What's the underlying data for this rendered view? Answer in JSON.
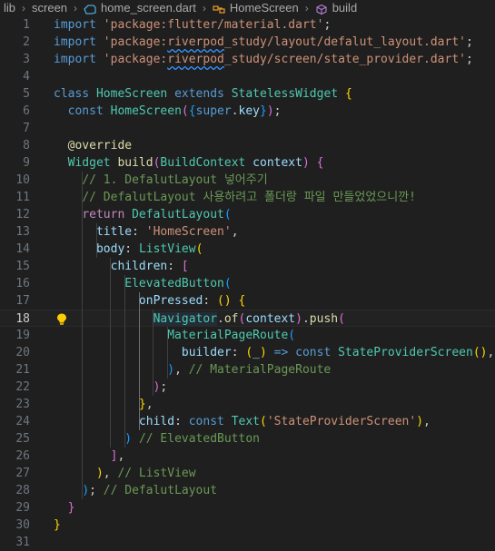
{
  "breadcrumb": {
    "items": [
      "lib",
      "screen",
      "home_screen.dart",
      "HomeScreen",
      "build"
    ]
  },
  "editor": {
    "active_line": 18,
    "lines": [
      {
        "n": "1",
        "tokens": [
          [
            "kw",
            "import"
          ],
          [
            "punc",
            " "
          ],
          [
            "str",
            "'package:flutter/material.dart'"
          ],
          [
            "punc",
            ";"
          ]
        ]
      },
      {
        "n": "2",
        "tokens": [
          [
            "kw",
            "import"
          ],
          [
            "punc",
            " "
          ],
          [
            "str",
            "'package:"
          ],
          [
            "str sq",
            "riverpod"
          ],
          [
            "str",
            "_study/layout/defalut_layout.dart'"
          ],
          [
            "punc",
            ";"
          ]
        ]
      },
      {
        "n": "3",
        "tokens": [
          [
            "kw",
            "import"
          ],
          [
            "punc",
            " "
          ],
          [
            "str",
            "'package:"
          ],
          [
            "str sq",
            "riverpod"
          ],
          [
            "str",
            "_study/screen/state_provider.dart'"
          ],
          [
            "punc",
            ";"
          ]
        ]
      },
      {
        "n": "4",
        "tokens": []
      },
      {
        "n": "5",
        "tokens": [
          [
            "kw",
            "class"
          ],
          [
            "punc",
            " "
          ],
          [
            "cls",
            "HomeScreen"
          ],
          [
            "punc",
            " "
          ],
          [
            "kw",
            "extends"
          ],
          [
            "punc",
            " "
          ],
          [
            "cls",
            "StatelessWidget"
          ],
          [
            "punc",
            " "
          ],
          [
            "b1",
            "{"
          ]
        ]
      },
      {
        "n": "6",
        "tokens": [
          [
            "punc",
            "  "
          ],
          [
            "kw",
            "const"
          ],
          [
            "punc",
            " "
          ],
          [
            "cls",
            "HomeScreen"
          ],
          [
            "b2",
            "("
          ],
          [
            "b3",
            "{"
          ],
          [
            "kw",
            "super"
          ],
          [
            "punc",
            "."
          ],
          [
            "var",
            "key"
          ],
          [
            "b3",
            "}"
          ],
          [
            "b2",
            ")"
          ],
          [
            "punc",
            ";"
          ]
        ]
      },
      {
        "n": "7",
        "tokens": []
      },
      {
        "n": "8",
        "tokens": [
          [
            "punc",
            "  "
          ],
          [
            "fn",
            "@override"
          ]
        ]
      },
      {
        "n": "9",
        "tokens": [
          [
            "punc",
            "  "
          ],
          [
            "cls",
            "Widget"
          ],
          [
            "punc",
            " "
          ],
          [
            "fn",
            "build"
          ],
          [
            "b2",
            "("
          ],
          [
            "cls",
            "BuildContext"
          ],
          [
            "punc",
            " "
          ],
          [
            "var",
            "context"
          ],
          [
            "b2",
            ")"
          ],
          [
            "punc",
            " "
          ],
          [
            "b2",
            "{"
          ]
        ]
      },
      {
        "n": "10",
        "tokens": [
          [
            "punc",
            "    "
          ],
          [
            "cmt",
            "// 1. DefalutLayout 넣어주기"
          ]
        ]
      },
      {
        "n": "11",
        "tokens": [
          [
            "punc",
            "    "
          ],
          [
            "cmt",
            "// DefalutLayout 사용하려고 폴더랑 파일 만들었었으니깐!"
          ]
        ]
      },
      {
        "n": "12",
        "tokens": [
          [
            "punc",
            "    "
          ],
          [
            "ctl",
            "return"
          ],
          [
            "punc",
            " "
          ],
          [
            "cls",
            "DefalutLayout"
          ],
          [
            "b3",
            "("
          ]
        ]
      },
      {
        "n": "13",
        "tokens": [
          [
            "punc",
            "      "
          ],
          [
            "var",
            "title"
          ],
          [
            "punc",
            ": "
          ],
          [
            "str",
            "'HomeScreen'"
          ],
          [
            "punc",
            ","
          ]
        ]
      },
      {
        "n": "14",
        "tokens": [
          [
            "punc",
            "      "
          ],
          [
            "var",
            "body"
          ],
          [
            "punc",
            ": "
          ],
          [
            "cls",
            "ListView"
          ],
          [
            "b1",
            "("
          ]
        ]
      },
      {
        "n": "15",
        "tokens": [
          [
            "punc",
            "        "
          ],
          [
            "var",
            "children"
          ],
          [
            "punc",
            ": "
          ],
          [
            "b2",
            "["
          ]
        ]
      },
      {
        "n": "16",
        "tokens": [
          [
            "punc",
            "          "
          ],
          [
            "cls",
            "ElevatedButton"
          ],
          [
            "b3",
            "("
          ]
        ]
      },
      {
        "n": "17",
        "tokens": [
          [
            "punc",
            "            "
          ],
          [
            "var",
            "onPressed"
          ],
          [
            "punc",
            ": "
          ],
          [
            "b1",
            "()"
          ],
          [
            "punc",
            " "
          ],
          [
            "b1",
            "{"
          ]
        ]
      },
      {
        "n": "18",
        "tokens": [
          [
            "punc",
            "              "
          ],
          [
            "cls hl",
            "Navigator"
          ],
          [
            "punc",
            "."
          ],
          [
            "fn",
            "of"
          ],
          [
            "b2",
            "("
          ],
          [
            "var",
            "context"
          ],
          [
            "b2",
            ")"
          ],
          [
            "punc",
            "."
          ],
          [
            "fn",
            "push"
          ],
          [
            "b2",
            "("
          ]
        ]
      },
      {
        "n": "19",
        "tokens": [
          [
            "punc",
            "                "
          ],
          [
            "cls",
            "MaterialPageRoute"
          ],
          [
            "b3",
            "("
          ]
        ]
      },
      {
        "n": "20",
        "tokens": [
          [
            "punc",
            "                  "
          ],
          [
            "var",
            "builder"
          ],
          [
            "punc",
            ": "
          ],
          [
            "b1",
            "("
          ],
          [
            "var",
            "_"
          ],
          [
            "b1",
            ")"
          ],
          [
            "punc",
            " "
          ],
          [
            "kw",
            "=>"
          ],
          [
            "punc",
            " "
          ],
          [
            "kw",
            "const"
          ],
          [
            "punc",
            " "
          ],
          [
            "cls",
            "StateProviderScreen"
          ],
          [
            "b1",
            "()"
          ],
          [
            "punc",
            ","
          ]
        ]
      },
      {
        "n": "21",
        "tokens": [
          [
            "punc",
            "                "
          ],
          [
            "b3",
            ")"
          ],
          [
            "punc",
            ", "
          ],
          [
            "cmt",
            "// MaterialPageRoute"
          ]
        ]
      },
      {
        "n": "22",
        "tokens": [
          [
            "punc",
            "              "
          ],
          [
            "b2",
            ")"
          ],
          [
            "punc",
            ";"
          ]
        ]
      },
      {
        "n": "23",
        "tokens": [
          [
            "punc",
            "            "
          ],
          [
            "b1",
            "}"
          ],
          [
            "punc",
            ","
          ]
        ]
      },
      {
        "n": "24",
        "tokens": [
          [
            "punc",
            "            "
          ],
          [
            "var",
            "child"
          ],
          [
            "punc",
            ": "
          ],
          [
            "kw",
            "const"
          ],
          [
            "punc",
            " "
          ],
          [
            "cls",
            "Text"
          ],
          [
            "b1",
            "("
          ],
          [
            "str",
            "'StateProviderScreen'"
          ],
          [
            "b1",
            ")"
          ],
          [
            "punc",
            ","
          ]
        ]
      },
      {
        "n": "25",
        "tokens": [
          [
            "punc",
            "          "
          ],
          [
            "b3",
            ")"
          ],
          [
            "punc",
            " "
          ],
          [
            "cmt",
            "// ElevatedButton"
          ]
        ]
      },
      {
        "n": "26",
        "tokens": [
          [
            "punc",
            "        "
          ],
          [
            "b2",
            "]"
          ],
          [
            "punc",
            ","
          ]
        ]
      },
      {
        "n": "27",
        "tokens": [
          [
            "punc",
            "      "
          ],
          [
            "b1",
            ")"
          ],
          [
            "punc",
            ", "
          ],
          [
            "cmt",
            "// ListView"
          ]
        ]
      },
      {
        "n": "28",
        "tokens": [
          [
            "punc",
            "    "
          ],
          [
            "b3",
            ")"
          ],
          [
            "punc",
            "; "
          ],
          [
            "cmt",
            "// DefalutLayout"
          ]
        ]
      },
      {
        "n": "29",
        "tokens": [
          [
            "punc",
            "  "
          ],
          [
            "b2",
            "}"
          ]
        ]
      },
      {
        "n": "30",
        "tokens": [
          [
            "b1",
            "}"
          ]
        ]
      },
      {
        "n": "31",
        "tokens": []
      }
    ]
  }
}
